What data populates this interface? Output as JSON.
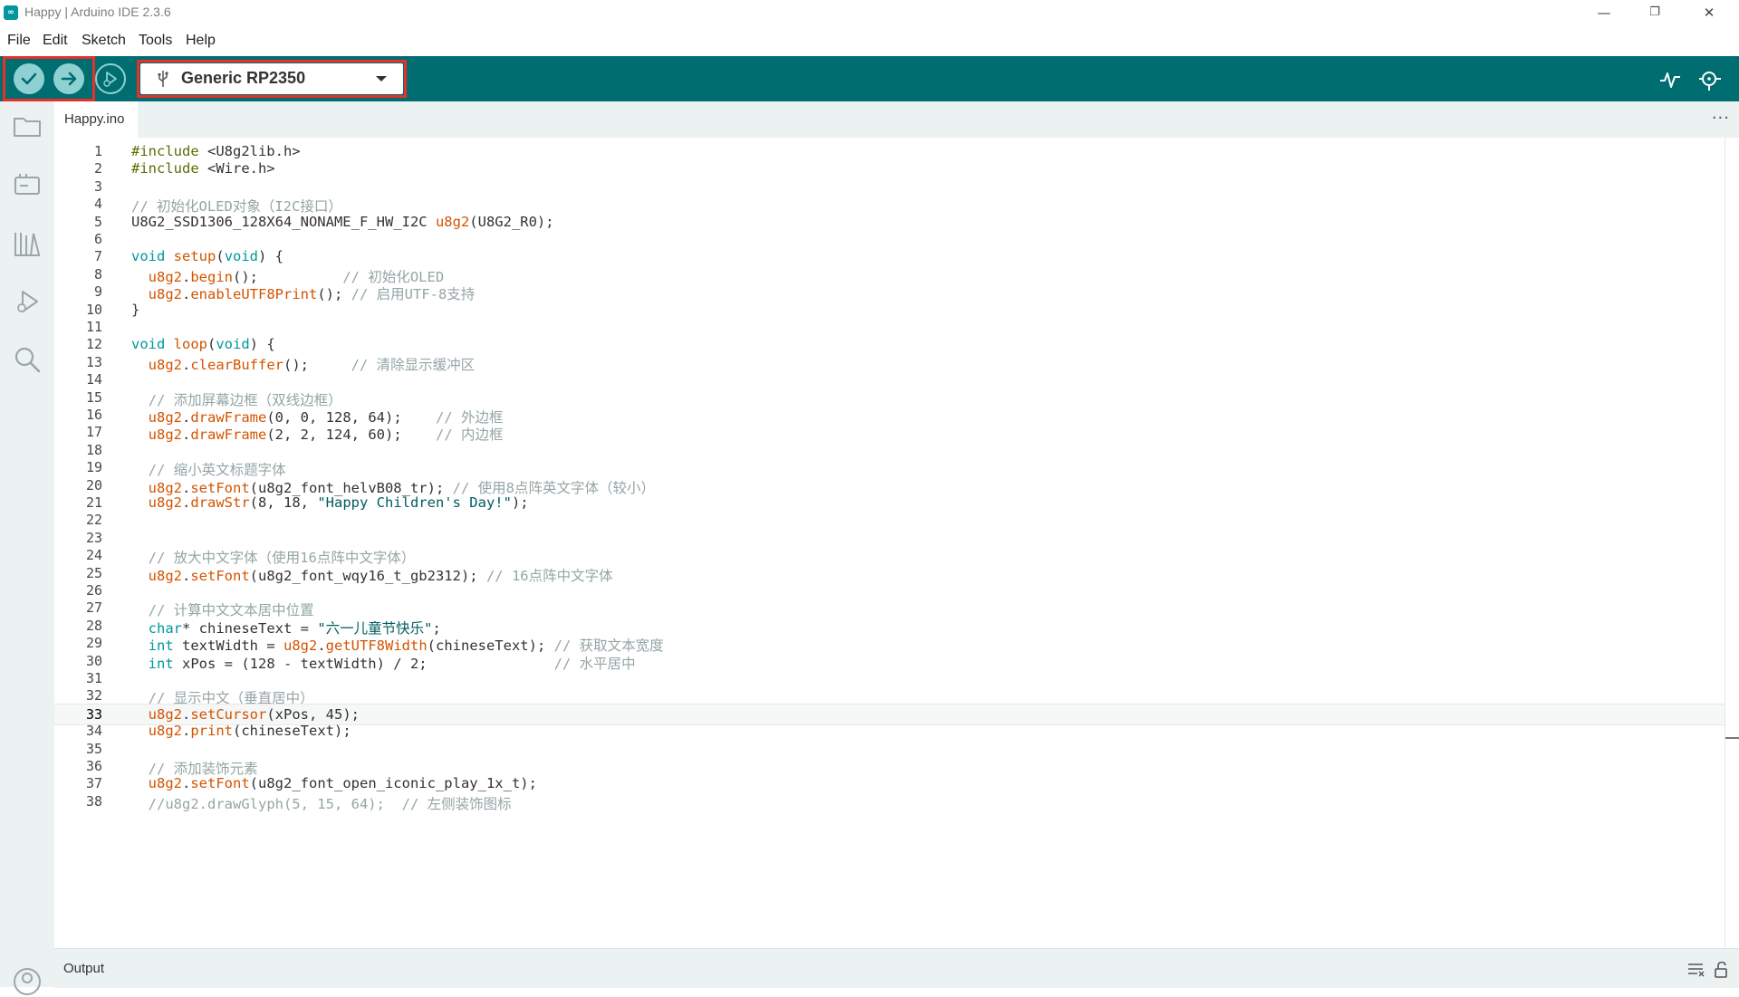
{
  "window": {
    "title": "Happy | Arduino IDE 2.3.6",
    "logo_glyph": "∞",
    "minimize": "—",
    "restore": "❐",
    "close": "✕"
  },
  "menu": [
    "File",
    "Edit",
    "Sketch",
    "Tools",
    "Help"
  ],
  "toolbar": {
    "verify_icon": "check-icon",
    "upload_icon": "arrow-right-icon",
    "debug_icon": "debug-icon",
    "board_name": "Generic RP2350",
    "accent": "#006d70",
    "highlight": "#e8302a"
  },
  "tab": {
    "label": "Happy.ino",
    "more": "···"
  },
  "code_lines": [
    "#include <U8g2lib.h>",
    "#include <Wire.h>",
    "",
    "// 初始化OLED对象（I2C接口）",
    "U8G2_SSD1306_128X64_NONAME_F_HW_I2C u8g2(U8G2_R0);",
    "",
    "void setup(void) {",
    "  u8g2.begin();          // 初始化OLED",
    "  u8g2.enableUTF8Print(); // 启用UTF-8支持",
    "}",
    "",
    "void loop(void) {",
    "  u8g2.clearBuffer();     // 清除显示缓冲区",
    "",
    "  // 添加屏幕边框（双线边框）",
    "  u8g2.drawFrame(0, 0, 128, 64);    // 外边框",
    "  u8g2.drawFrame(2, 2, 124, 60);    // 内边框",
    "",
    "  // 缩小英文标题字体",
    "  u8g2.setFont(u8g2_font_helvB08_tr); // 使用8点阵英文字体（较小）",
    "  u8g2.drawStr(8, 18, \"Happy Children's Day!\");",
    "",
    "",
    "  // 放大中文字体（使用16点阵中文字体）",
    "  u8g2.setFont(u8g2_font_wqy16_t_gb2312); // 16点阵中文字体",
    "",
    "  // 计算中文文本居中位置",
    "  char* chineseText = \"六一儿童节快乐\";",
    "  int textWidth = u8g2.getUTF8Width(chineseText); // 获取文本宽度",
    "  int xPos = (128 - textWidth) / 2;               // 水平居中",
    "",
    "  // 显示中文（垂直居中）",
    "  u8g2.setCursor(xPos, 45);",
    "  u8g2.print(chineseText);",
    "",
    "  // 添加装饰元素",
    "  u8g2.setFont(u8g2_font_open_iconic_play_1x_t);",
    "  //u8g2.drawGlyph(5, 15, 64);  // 左侧装饰图标"
  ],
  "current_line": 33,
  "output": {
    "label": "Output"
  }
}
